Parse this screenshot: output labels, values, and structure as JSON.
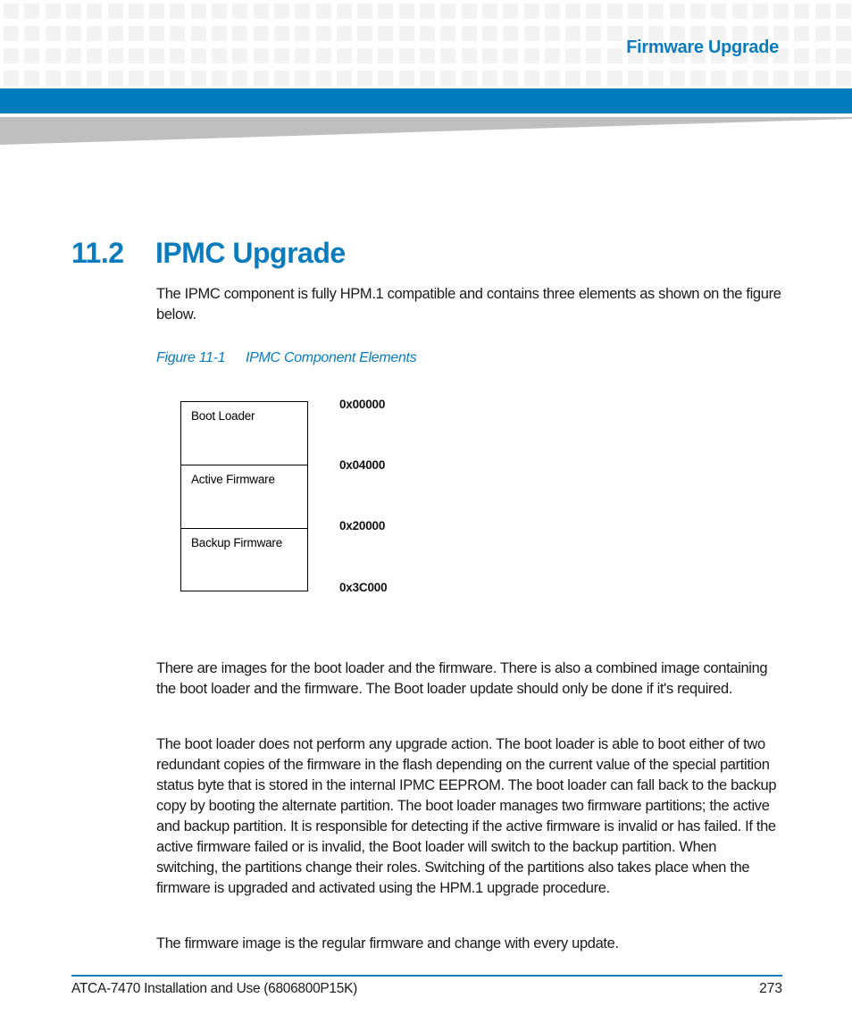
{
  "header": {
    "running_title": "Firmware Upgrade",
    "accent_color": "#027cbd"
  },
  "section": {
    "number": "11.2",
    "title": "IPMC Upgrade"
  },
  "paragraphs": {
    "intro": "The IPMC component is fully HPM.1 compatible and contains three elements as shown on the figure below.",
    "images": "There are images for the boot loader and the firmware. There is also a combined image containing the boot loader and the firmware. The Boot loader update should only be done if it's required.",
    "boot_loader": "The boot loader does not perform any upgrade action. The boot loader is able to boot either of two redundant copies of the firmware in the flash depending on the current value of the special partition status byte that is stored in the internal IPMC EEPROM. The boot loader can fall back to the backup copy by booting the alternate partition. The boot loader manages two firmware partitions; the active and backup partition. It is responsible for detecting if the active firmware is invalid or has failed. If the active firmware failed or is invalid, the Boot loader will switch to the backup partition. When switching, the partitions change their roles. Switching of the partitions also takes place when the firmware is upgraded and activated using the HPM.1 upgrade procedure.",
    "firmware_image": "The firmware image is the regular firmware and change with every update."
  },
  "figure": {
    "number": "Figure 11-1",
    "caption": "IPMC Component Elements",
    "blocks": [
      {
        "label": "Boot Loader"
      },
      {
        "label": "Active Firmware"
      },
      {
        "label": "Backup Firmware"
      }
    ],
    "addresses": [
      "0x00000",
      "0x04000",
      "0x20000",
      "0x3C000"
    ]
  },
  "footer": {
    "document": "ATCA-7470 Installation and Use (6806800P15K)",
    "page_number": "273"
  }
}
